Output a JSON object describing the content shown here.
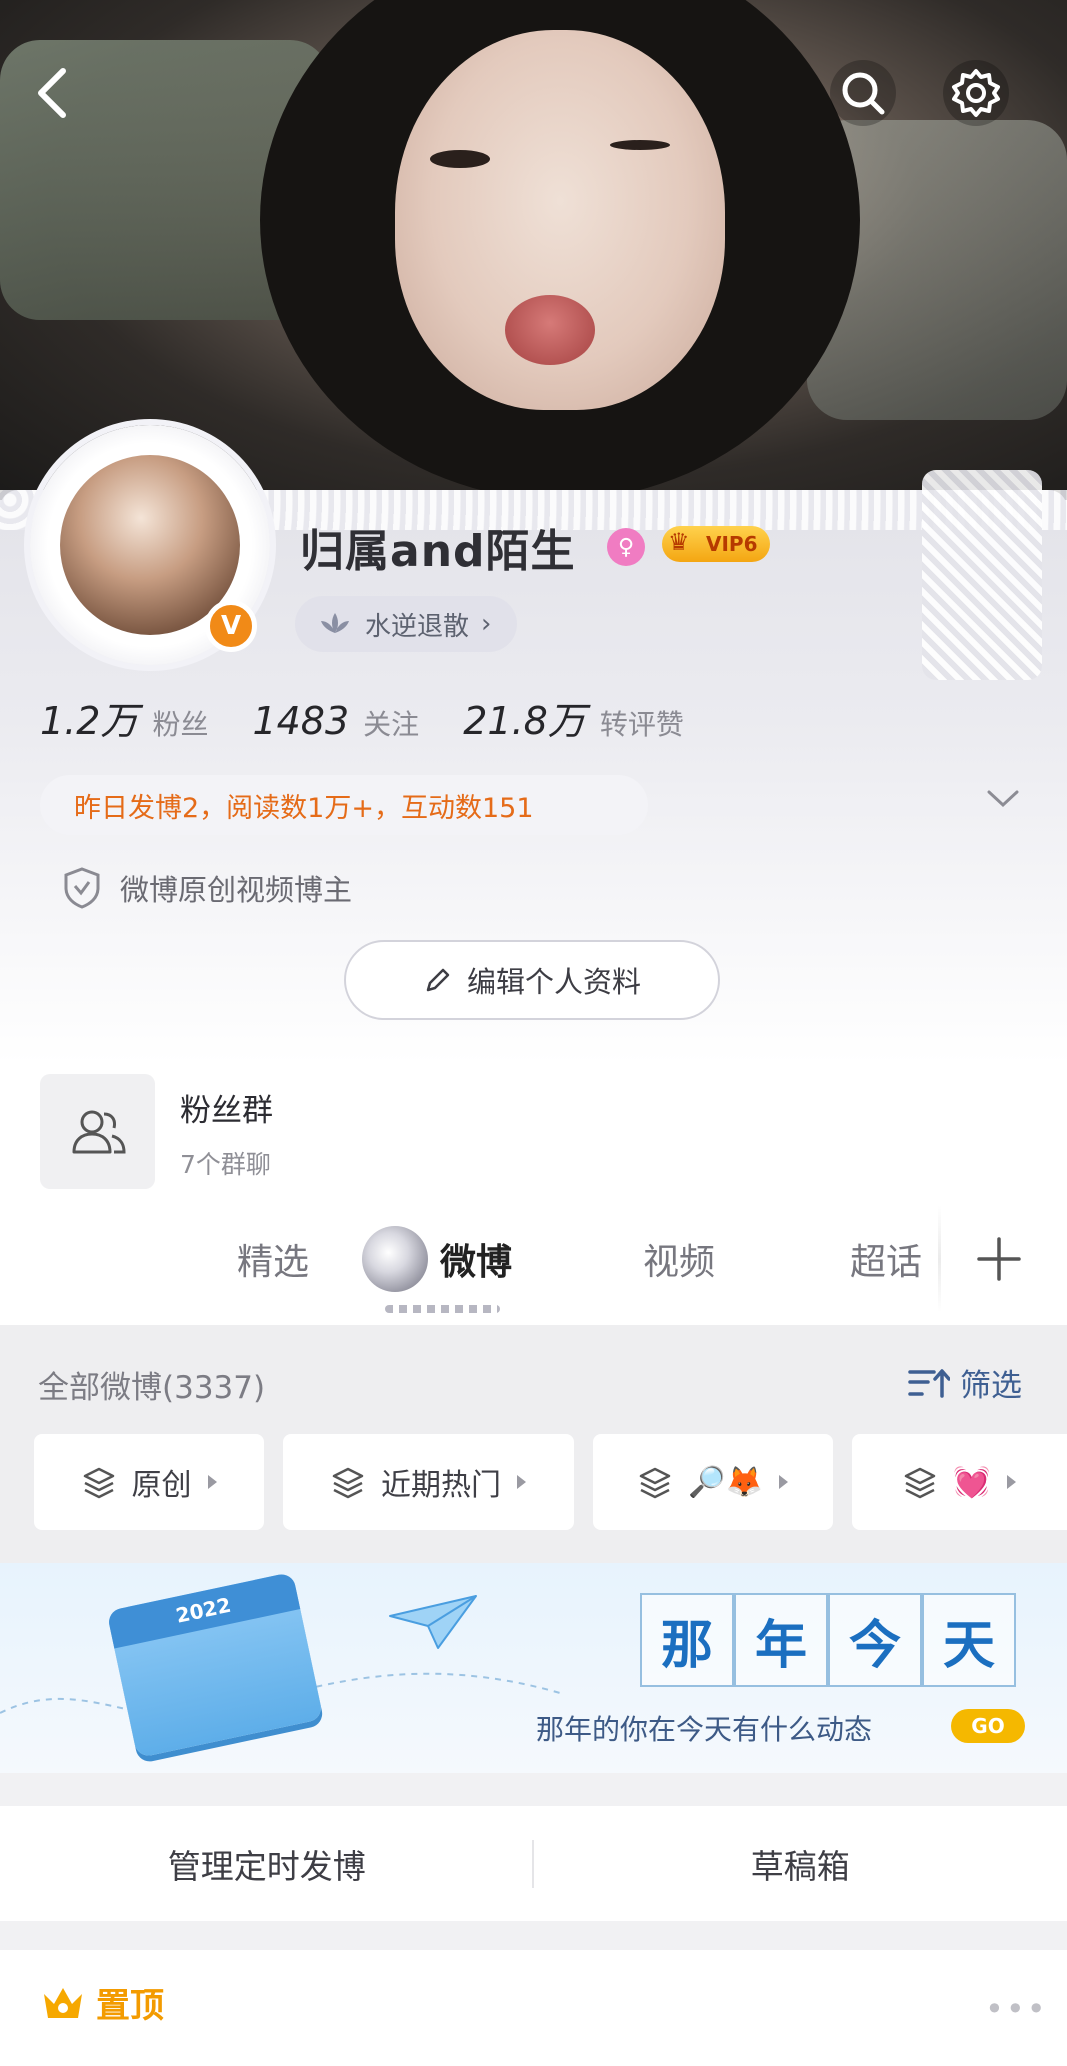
{
  "profile": {
    "username": "归属and陌生",
    "vip_label": "VIP6",
    "verified_badge": "V",
    "tag": "水逆退散",
    "stats": [
      {
        "value": "1.2万",
        "label": "粉丝"
      },
      {
        "value": "1483",
        "label": "关注"
      },
      {
        "value": "21.8万",
        "label": "转评赞"
      }
    ],
    "activity": "昨日发博2，阅读数1万+，互动数151",
    "certification": "微博原创视频博主",
    "edit_label": "编辑个人资料"
  },
  "fan_group": {
    "title": "粉丝群",
    "subtitle": "7个群聊"
  },
  "tabs": {
    "featured": "精选",
    "weibo": "微博",
    "video": "视频",
    "super_topic": "超话"
  },
  "filter": {
    "all_label": "全部微博(3337)",
    "filter_label": "筛选",
    "chips": [
      "原创",
      "近期热门",
      "🔎🦊",
      "💓"
    ]
  },
  "banner": {
    "calendar_year": "2022",
    "title_chars": [
      "那",
      "年",
      "今",
      "天"
    ],
    "subtitle": "那年的你在今天有什么动态",
    "go": "GO"
  },
  "actions": {
    "scheduled": "管理定时发博",
    "drafts": "草稿箱"
  },
  "pinned": {
    "label": "置顶"
  },
  "colors": {
    "activity_text": "#e56b18",
    "vip_gold": "#f4a612",
    "verified_orange": "#f18a17",
    "link_blue": "#3e5f92",
    "pinned_orange": "#f39b00"
  }
}
